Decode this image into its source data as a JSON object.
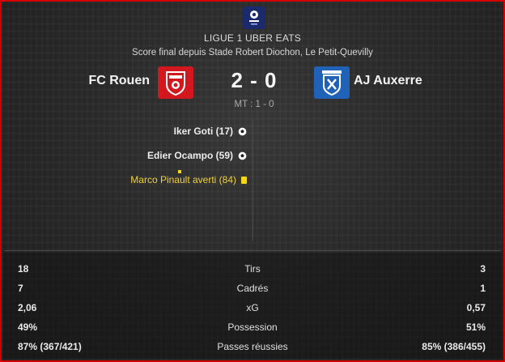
{
  "competition": "LIGUE 1 UBER EATS",
  "subtitle": "Score final depuis Stade Robert Diochon, Le Petit-Quevilly",
  "league_logo_icon": "ligue1-logo-icon",
  "home": {
    "name": "FC Rouen",
    "crest_icon": "fc-rouen-crest-icon",
    "crest_color": "#d3171e"
  },
  "away": {
    "name": "AJ Auxerre",
    "crest_icon": "aj-auxerre-crest-icon",
    "crest_color": "#1f62b8"
  },
  "score": "2 - 0",
  "halftime": "MT : 1 - 0",
  "events": [
    {
      "text": "Iker Goti (17)",
      "type": "goal",
      "icon": "football-icon"
    },
    {
      "text": "Edier Ocampo (59)",
      "type": "goal",
      "icon": "football-icon"
    },
    {
      "text": "Marco Pinault averti (84)",
      "type": "booking",
      "icon": "yellow-card-icon"
    }
  ],
  "stats": [
    {
      "home": "18",
      "label": "Tirs",
      "away": "3"
    },
    {
      "home": "7",
      "label": "Cadrés",
      "away": "1"
    },
    {
      "home": "2,06",
      "label": "xG",
      "away": "0,57"
    },
    {
      "home": "49%",
      "label": "Possession",
      "away": "51%"
    },
    {
      "home": "87% (367/421)",
      "label": "Passes réussies",
      "away": "85% (386/455)"
    }
  ],
  "colors": {
    "frame_border": "#d40000",
    "booking_text": "#f1d23c"
  }
}
